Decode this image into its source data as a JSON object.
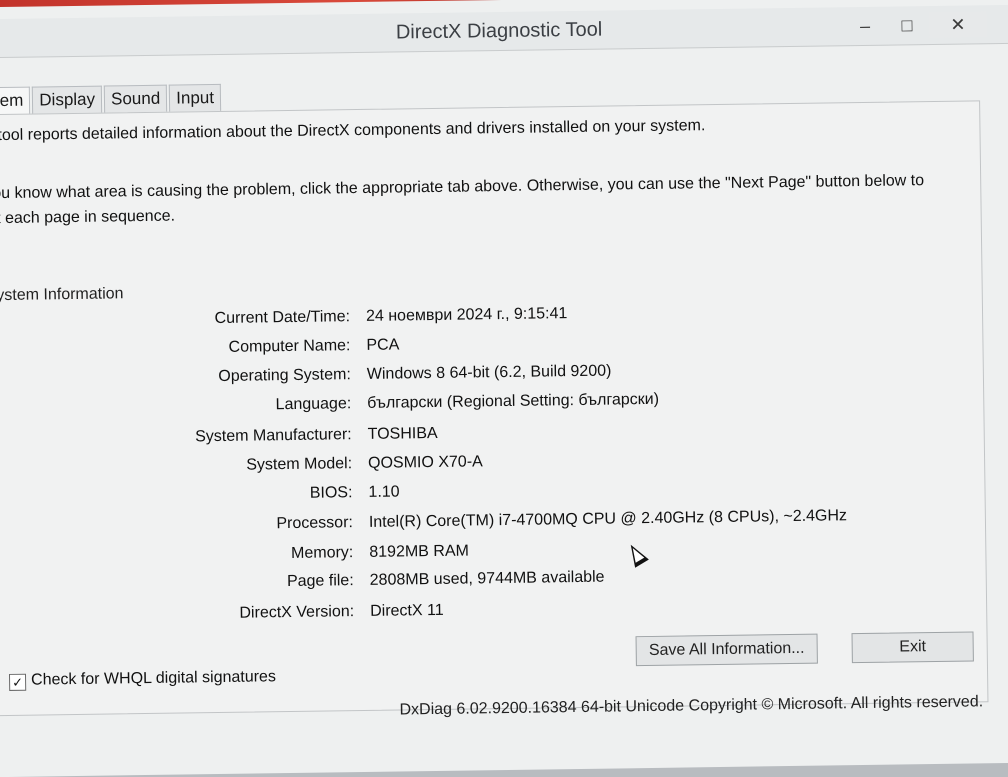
{
  "window": {
    "title": "DirectX Diagnostic Tool",
    "controls": {
      "minimize": "–",
      "maximize": "□",
      "close": "✕"
    }
  },
  "tabs": [
    {
      "label": "tem"
    },
    {
      "label": "Display"
    },
    {
      "label": "Sound"
    },
    {
      "label": "Input"
    }
  ],
  "intro": {
    "line1": "is tool reports detailed information about the DirectX components and drivers installed on your system.",
    "line2": "you know what area is causing the problem, click the appropriate tab above.  Otherwise, you can use the \"Next Page\" button below to sit each page in sequence."
  },
  "section": {
    "label": "System Information"
  },
  "system_info": [
    {
      "label": "Current Date/Time:",
      "value": "24 ноември 2024 г., 9:15:41"
    },
    {
      "label": "Computer Name:",
      "value": "PCA"
    },
    {
      "label": "Operating System:",
      "value": "Windows 8 64-bit (6.2, Build 9200)"
    },
    {
      "label": "Language:",
      "value": "български (Regional Setting: български)"
    },
    {
      "label": "System Manufacturer:",
      "value": "TOSHIBA"
    },
    {
      "label": "System Model:",
      "value": "QOSMIO X70-A"
    },
    {
      "label": "BIOS:",
      "value": "1.10"
    },
    {
      "label": "Processor:",
      "value": "Intel(R) Core(TM) i7-4700MQ CPU @ 2.40GHz (8 CPUs), ~2.4GHz"
    },
    {
      "label": "Memory:",
      "value": "8192MB RAM"
    },
    {
      "label": "Page file:",
      "value": "2808MB used, 9744MB available"
    },
    {
      "label": "DirectX Version:",
      "value": "DirectX 11"
    }
  ],
  "whql": {
    "label": "Check for WHQL digital signatures",
    "checked": true,
    "check_glyph": "✓"
  },
  "footer": {
    "text": "DxDiag 6.02.9200.16384 64-bit Unicode  Copyright © Microsoft. All rights reserved."
  },
  "buttons": {
    "save": "Save All Information...",
    "exit": "Exit"
  }
}
